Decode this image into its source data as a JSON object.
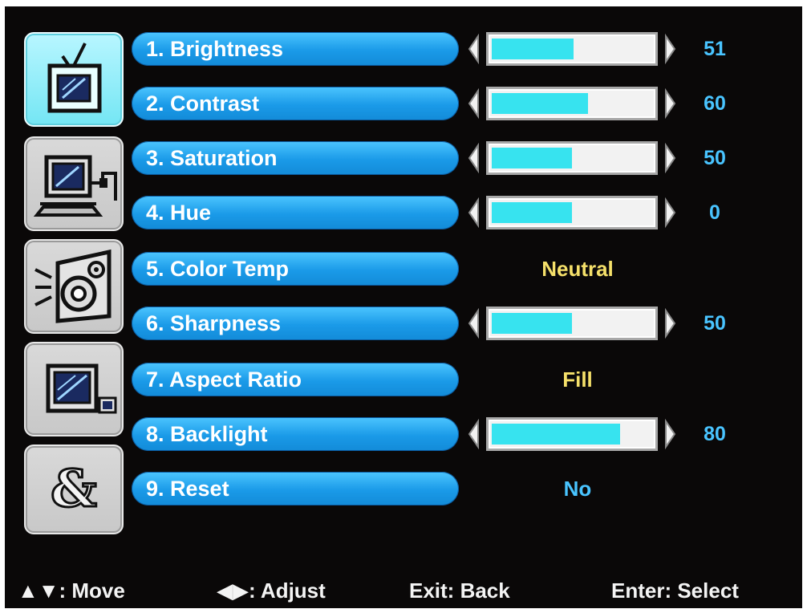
{
  "menu": {
    "items": [
      {
        "label": "1. Brightness",
        "type": "slider",
        "value": "51",
        "level": 0.51
      },
      {
        "label": "2. Contrast",
        "type": "slider",
        "value": "60",
        "level": 0.6
      },
      {
        "label": "3. Saturation",
        "type": "slider",
        "value": "50",
        "level": 0.5
      },
      {
        "label": "4. Hue",
        "type": "slider",
        "value": "0",
        "level": 0.5
      },
      {
        "label": "5. Color Temp",
        "type": "option",
        "value": "Neutral",
        "value_color": "#f5e06a"
      },
      {
        "label": "6. Sharpness",
        "type": "slider",
        "value": "50",
        "level": 0.5
      },
      {
        "label": "7. Aspect Ratio",
        "type": "option",
        "value": "Fill",
        "value_color": "#f5e06a"
      },
      {
        "label": "8. Backlight",
        "type": "slider",
        "value": "80",
        "level": 0.8
      },
      {
        "label": "9. Reset",
        "type": "option",
        "value": "No",
        "value_color": "#49c4ff"
      }
    ]
  },
  "tabs": [
    {
      "icon": "tv-icon",
      "active": true
    },
    {
      "icon": "pc-input-icon",
      "active": false
    },
    {
      "icon": "audio-speaker-icon",
      "active": false
    },
    {
      "icon": "pip-icon",
      "active": false
    },
    {
      "icon": "ampersand-icon",
      "active": false,
      "glyph": "&"
    }
  ],
  "footer": {
    "move_symbol": "▲▼",
    "move_text": ": Move",
    "adjust_symbol": "◀▶",
    "adjust_text": ": Adjust",
    "exit_text": "Exit: Back",
    "enter_text": "Enter: Select"
  },
  "colors": {
    "pill": "#1a9ae8",
    "bar_fill": "#37e3ef",
    "value_blue": "#49c4ff",
    "option_yellow": "#f5e06a",
    "active_tab": "#8debf7"
  }
}
